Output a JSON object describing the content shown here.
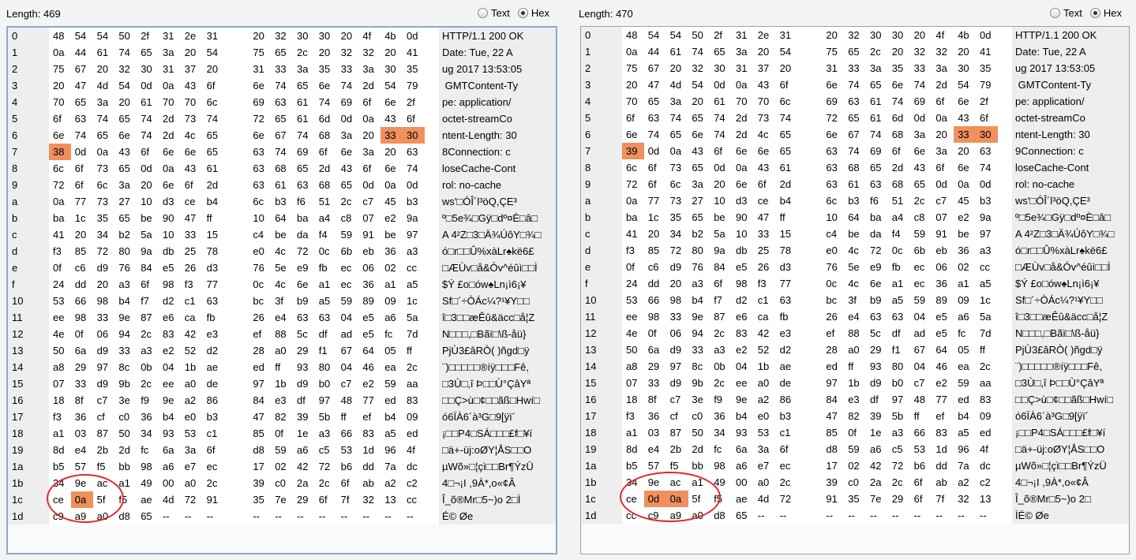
{
  "radio_labels": {
    "text": "Text",
    "hex": "Hex"
  },
  "accent": {
    "highlight": "#f0905e",
    "circle": "#e8242c"
  },
  "panes": [
    {
      "length_label": "Length: 469",
      "mode": "hex",
      "rows": [
        {
          "off": "0",
          "hex": "48 54 54 50 2f 31 2e 31 20 32 30 30 20 4f 4b 0d",
          "ascii": "HTTP/1.1 200 OK"
        },
        {
          "off": "1",
          "hex": "0a 44 61 74 65 3a 20 54 75 65 2c 20 32 32 20 41",
          "ascii": "Date: Tue, 22 A"
        },
        {
          "off": "2",
          "hex": "75 67 20 32 30 31 37 20 31 33 3a 35 33 3a 30 35",
          "ascii": "ug 2017 13:53:05"
        },
        {
          "off": "3",
          "hex": "20 47 4d 54 0d 0a 43 6f 6e 74 65 6e 74 2d 54 79",
          "ascii": " GMTContent-Ty"
        },
        {
          "off": "4",
          "hex": "70 65 3a 20 61 70 70 6c 69 63 61 74 69 6f 6e 2f",
          "ascii": "pe: application/"
        },
        {
          "off": "5",
          "hex": "6f 63 74 65 74 2d 73 74 72 65 61 6d 0d 0a 43 6f",
          "ascii": "octet-streamCo"
        },
        {
          "off": "6",
          "hex": "6e 74 65 6e 74 2d 4c 65 6e 67 74 68 3a 20 33 30",
          "ascii": "ntent-Length: 30"
        },
        {
          "off": "7",
          "hex": "38 0d 0a 43 6f 6e 6e 65 63 74 69 6f 6e 3a 20 63",
          "ascii": "8Connection: c"
        },
        {
          "off": "8",
          "hex": "6c 6f 73 65 0d 0a 43 61 63 68 65 2d 43 6f 6e 74",
          "ascii": "loseCache-Cont"
        },
        {
          "off": "9",
          "hex": "72 6f 6c 3a 20 6e 6f 2d 63 61 63 68 65 0d 0a 0d",
          "ascii": "rol: no-cache"
        },
        {
          "off": "a",
          "hex": "0a 77 73 27 10 d3 ce b4 6c b3 f6 51 2c c7 45 b3",
          "ascii": "ws'□ÓÎ´l³öQ,ÇE³"
        },
        {
          "off": "b",
          "hex": "ba 1c 35 65 be 90 47 ff 10 64 ba a4 c8 07 e2 9a",
          "ascii": "º□5e¾□Gÿ□dº¤È□â□"
        },
        {
          "off": "c",
          "hex": "41 20 34 b2 5a 10 33 15 c4 be da f4 59 91 be 97",
          "ascii": "A 4²Z□3□Ä¾ÚôY□¾□"
        },
        {
          "off": "d",
          "hex": "f3 85 72 80 9a db 25 78 e0 4c 72 0c 6b eb 36 a3",
          "ascii": "ó□r□□Û%xàLr♠kë6£"
        },
        {
          "off": "e",
          "hex": "0f c6 d9 76 84 e5 26 d3 76 5e e9 fb ec 06 02 cc",
          "ascii": "□ÆÙv□å&Óv^éûì□□Ì"
        },
        {
          "off": "f",
          "hex": "24 dd 20 a3 6f 98 f3 77 0c 4c 6e a1 ec 36 a1 a5",
          "ascii": "$Ý £o□ów♠Ln¡ì6¡¥"
        },
        {
          "off": "10",
          "hex": "53 66 98 b4 f7 d2 c1 63 bc 3f b9 a5 59 89 09 1c",
          "ascii": "Sf□´÷ÒÁc¼?¹¥Y□□"
        },
        {
          "off": "11",
          "hex": "ee 98 33 9e 87 e6 ca fb 26 e4 63 63 04 e5 a6 5a",
          "ascii": "î□3□□æÊû&äcc□å¦Z"
        },
        {
          "off": "12",
          "hex": "4e 0f 06 94 2c 83 42 e3 ef 88 5c df ad e5 fc 7d",
          "ascii": "N□□□,□Bãï□\\ß-åü}"
        },
        {
          "off": "13",
          "hex": "50 6a d9 33 a3 e2 52 d2 28 a0 29 f1 67 64 05 ff",
          "ascii": "PjÙ3£âRÒ( )ñgd□ÿ"
        },
        {
          "off": "14",
          "hex": "a8 29 97 8c 0b 04 1b ae ed ff 93 80 04 46 ea 2c",
          "ascii": "¨)□□□□□®íÿ□□□Fê,"
        },
        {
          "off": "15",
          "hex": "07 33 d9 9b 2c ee a0 de 97 1b d9 b0 c7 e2 59 aa",
          "ascii": "□3Ù□,î Þ□□Ù°ÇâYª"
        },
        {
          "off": "16",
          "hex": "18 8f c7 3e f9 9e a2 86 84 e3 df 97 48 77 ed 83",
          "ascii": "□□Ç>ù□¢□□ãß□Hwí□"
        },
        {
          "off": "17",
          "hex": "f3 36 cf c0 36 b4 e0 b3 47 82 39 5b ff ef b4 09",
          "ascii": "ó6ÏÀ6´à³G□9[ÿï´"
        },
        {
          "off": "18",
          "hex": "a1 03 87 50 34 93 53 c1 85 0f 1e a3 66 83 a5 ed",
          "ascii": "¡□□P4□SÁ□□□£f□¥í"
        },
        {
          "off": "19",
          "hex": "8d e4 2b 2d fc 6a 3a 6f d8 59 a6 c5 53 1d 96 4f",
          "ascii": "□ä+-üj:oØY¦ÅS□□O"
        },
        {
          "off": "1a",
          "hex": "b5 57 f5 bb 98 a6 e7 ec 17 02 42 72 b6 dd 7a dc",
          "ascii": "µWõ»□¦çì□□Br¶ÝzÜ"
        },
        {
          "off": "1b",
          "hex": "34 9e ac a1 49 00 a0 2c 39 c0 2a 2c 6f ab a2 c2",
          "ascii": "4□¬¡I ,9À*,o«¢Â"
        },
        {
          "off": "1c",
          "hex": "ce 0a 5f f5 ae 4d 72 91 35 7e 29 6f 7f 32 13 cc",
          "ascii": "Î_õ®Mr□5~)o 2□Ì"
        },
        {
          "off": "1d",
          "hex": "c9 a9 a0 d8 65 -- -- -- -- -- -- -- -- -- -- --",
          "ascii": "É© Øe"
        }
      ],
      "highlights": [
        [
          6,
          14
        ],
        [
          6,
          15
        ],
        [
          7,
          0
        ],
        [
          28,
          1
        ]
      ]
    },
    {
      "length_label": "Length: 470",
      "mode": "hex",
      "rows": [
        {
          "off": "0",
          "hex": "48 54 54 50 2f 31 2e 31 20 32 30 30 20 4f 4b 0d",
          "ascii": "HTTP/1.1 200 OK"
        },
        {
          "off": "1",
          "hex": "0a 44 61 74 65 3a 20 54 75 65 2c 20 32 32 20 41",
          "ascii": "Date: Tue, 22 A"
        },
        {
          "off": "2",
          "hex": "75 67 20 32 30 31 37 20 31 33 3a 35 33 3a 30 35",
          "ascii": "ug 2017 13:53:05"
        },
        {
          "off": "3",
          "hex": "20 47 4d 54 0d 0a 43 6f 6e 74 65 6e 74 2d 54 79",
          "ascii": " GMTContent-Ty"
        },
        {
          "off": "4",
          "hex": "70 65 3a 20 61 70 70 6c 69 63 61 74 69 6f 6e 2f",
          "ascii": "pe: application/"
        },
        {
          "off": "5",
          "hex": "6f 63 74 65 74 2d 73 74 72 65 61 6d 0d 0a 43 6f",
          "ascii": "octet-streamCo"
        },
        {
          "off": "6",
          "hex": "6e 74 65 6e 74 2d 4c 65 6e 67 74 68 3a 20 33 30",
          "ascii": "ntent-Length: 30"
        },
        {
          "off": "7",
          "hex": "39 0d 0a 43 6f 6e 6e 65 63 74 69 6f 6e 3a 20 63",
          "ascii": "9Connection: c"
        },
        {
          "off": "8",
          "hex": "6c 6f 73 65 0d 0a 43 61 63 68 65 2d 43 6f 6e 74",
          "ascii": "loseCache-Cont"
        },
        {
          "off": "9",
          "hex": "72 6f 6c 3a 20 6e 6f 2d 63 61 63 68 65 0d 0a 0d",
          "ascii": "rol: no-cache"
        },
        {
          "off": "a",
          "hex": "0a 77 73 27 10 d3 ce b4 6c b3 f6 51 2c c7 45 b3",
          "ascii": "ws'□ÓÎ´l³öQ,ÇE³"
        },
        {
          "off": "b",
          "hex": "ba 1c 35 65 be 90 47 ff 10 64 ba a4 c8 07 e2 9a",
          "ascii": "º□5e¾□Gÿ□dº¤È□â□"
        },
        {
          "off": "c",
          "hex": "41 20 34 b2 5a 10 33 15 c4 be da f4 59 91 be 97",
          "ascii": "A 4²Z□3□Ä¾ÚôY□¾□"
        },
        {
          "off": "d",
          "hex": "f3 85 72 80 9a db 25 78 e0 4c 72 0c 6b eb 36 a3",
          "ascii": "ó□r□□Û%xàLr♠kë6£"
        },
        {
          "off": "e",
          "hex": "0f c6 d9 76 84 e5 26 d3 76 5e e9 fb ec 06 02 cc",
          "ascii": "□ÆÙv□å&Óv^éûì□□Ì"
        },
        {
          "off": "f",
          "hex": "24 dd 20 a3 6f 98 f3 77 0c 4c 6e a1 ec 36 a1 a5",
          "ascii": "$Ý £o□ów♠Ln¡ì6¡¥"
        },
        {
          "off": "10",
          "hex": "53 66 98 b4 f7 d2 c1 63 bc 3f b9 a5 59 89 09 1c",
          "ascii": "Sf□´÷ÒÁc¼?¹¥Y□□"
        },
        {
          "off": "11",
          "hex": "ee 98 33 9e 87 e6 ca fb 26 e4 63 63 04 e5 a6 5a",
          "ascii": "î□3□□æÊû&äcc□å¦Z"
        },
        {
          "off": "12",
          "hex": "4e 0f 06 94 2c 83 42 e3 ef 88 5c df ad e5 fc 7d",
          "ascii": "N□□□,□Bãï□\\ß-åü}"
        },
        {
          "off": "13",
          "hex": "50 6a d9 33 a3 e2 52 d2 28 a0 29 f1 67 64 05 ff",
          "ascii": "PjÙ3£âRÒ( )ñgd□ÿ"
        },
        {
          "off": "14",
          "hex": "a8 29 97 8c 0b 04 1b ae ed ff 93 80 04 46 ea 2c",
          "ascii": "¨)□□□□□®íÿ□□□Fê,"
        },
        {
          "off": "15",
          "hex": "07 33 d9 9b 2c ee a0 de 97 1b d9 b0 c7 e2 59 aa",
          "ascii": "□3Ù□,î Þ□□Ù°ÇâYª"
        },
        {
          "off": "16",
          "hex": "18 8f c7 3e f9 9e a2 86 84 e3 df 97 48 77 ed 83",
          "ascii": "□□Ç>ù□¢□□ãß□Hwí□"
        },
        {
          "off": "17",
          "hex": "f3 36 cf c0 36 b4 e0 b3 47 82 39 5b ff ef b4 09",
          "ascii": "ó6ÏÀ6´à³G□9[ÿï´"
        },
        {
          "off": "18",
          "hex": "a1 03 87 50 34 93 53 c1 85 0f 1e a3 66 83 a5 ed",
          "ascii": "¡□□P4□SÁ□□□£f□¥í"
        },
        {
          "off": "19",
          "hex": "8d e4 2b 2d fc 6a 3a 6f d8 59 a6 c5 53 1d 96 4f",
          "ascii": "□ä+-üj:oØY¦ÅS□□O"
        },
        {
          "off": "1a",
          "hex": "b5 57 f5 bb 98 a6 e7 ec 17 02 42 72 b6 dd 7a dc",
          "ascii": "µWõ»□¦çì□□Br¶ÝzÜ"
        },
        {
          "off": "1b",
          "hex": "34 9e ac a1 49 00 a0 2c 39 c0 2a 2c 6f ab a2 c2",
          "ascii": "4□¬¡I ,9À*,o«¢Â"
        },
        {
          "off": "1c",
          "hex": "ce 0d 0a 5f f5 ae 4d 72 91 35 7e 29 6f 7f 32 13",
          "ascii": "Î_õ®Mr□5~)o 2□"
        },
        {
          "off": "1d",
          "hex": "cc c9 a9 a0 d8 65 -- -- -- -- -- -- -- -- -- --",
          "ascii": "ÌÉ© Øe"
        }
      ],
      "highlights": [
        [
          6,
          14
        ],
        [
          6,
          15
        ],
        [
          7,
          0
        ],
        [
          28,
          1
        ],
        [
          28,
          2
        ]
      ]
    }
  ]
}
